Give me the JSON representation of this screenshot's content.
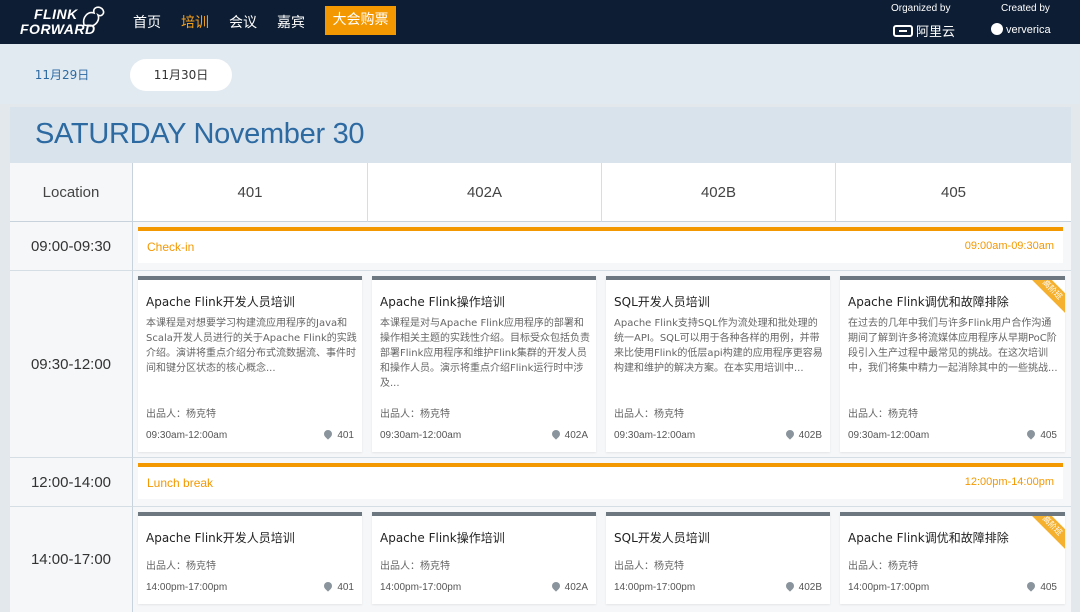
{
  "brand": {
    "line1": "FLINK",
    "line2": "FORWARD"
  },
  "nav": {
    "items": [
      {
        "label": "首页"
      },
      {
        "label": "培训"
      },
      {
        "label": "会议"
      },
      {
        "label": "嘉宾"
      }
    ],
    "active_item": "培训",
    "ticket_label": "大会购票",
    "ticket_color": "#f39800"
  },
  "sponsors": {
    "organized_label": "Organized by",
    "organizer": "阿里云",
    "created_label": "Created by",
    "creator": "ververica"
  },
  "dates": {
    "tabs": [
      {
        "label": "11月29日"
      },
      {
        "label": "11月30日"
      }
    ],
    "selected": "11月30日"
  },
  "day_title": "SATURDAY November 30",
  "columns": {
    "location_label": "Location",
    "rooms": [
      "401",
      "402A",
      "402B",
      "405"
    ]
  },
  "slots": {
    "checkin": {
      "time": "09:00-09:30",
      "label": "Check-in",
      "range": "09:00am-09:30am"
    },
    "morning": {
      "time": "09:30-12:00"
    },
    "lunch": {
      "time": "12:00-14:00",
      "label": "Lunch break",
      "range": "12:00pm-14:00pm"
    },
    "afternoon": {
      "time": "14:00-17:00"
    }
  },
  "morning_sessions": [
    {
      "title": "Apache Flink开发人员培训",
      "desc": "本课程是对想要学习构建流应用程序的Java和Scala开发人员进行的关于Apache Flink的实践介绍。演讲将重点介绍分布式流数据流、事件时间和键分区状态的核心概念...",
      "producer": "出品人：杨克特",
      "time": "09:30am-12:00am",
      "room": "401"
    },
    {
      "title": "Apache Flink操作培训",
      "desc": "本课程是对与Apache Flink应用程序的部署和操作相关主题的实践性介绍。目标受众包括负责部署Flink应用程序和维护Flink集群的开发人员和操作人员。演示将重点介绍Flink运行时中涉及...",
      "producer": "出品人：杨克特",
      "time": "09:30am-12:00am",
      "room": "402A"
    },
    {
      "title": "SQL开发人员培训",
      "desc": "Apache Flink支持SQL作为流处理和批处理的统一API。SQL可以用于各种各样的用例，并带来比使用Flink的低层api构建的应用程序更容易构建和维护的解决方案。在本实用培训中...",
      "producer": "出品人：杨克特",
      "time": "09:30am-12:00am",
      "room": "402B"
    },
    {
      "title": "Apache Flink调优和故障排除",
      "desc": "在过去的几年中我们与许多Flink用户合作沟通期间了解到许多将流媒体应用程序从早期PoC阶段引入生产过程中最常见的挑战。在这次培训中，我们将集中精力一起消除其中的一些挑战...",
      "producer": "出品人：杨克特",
      "time": "09:30am-12:00am",
      "room": "405",
      "badge": "高阶班"
    }
  ],
  "afternoon_sessions": [
    {
      "title": "Apache Flink开发人员培训",
      "producer": "出品人：杨克特",
      "time": "14:00pm-17:00pm",
      "room": "401"
    },
    {
      "title": "Apache Flink操作培训",
      "producer": "出品人：杨克特",
      "time": "14:00pm-17:00pm",
      "room": "402A"
    },
    {
      "title": "SQL开发人员培训",
      "producer": "出品人：杨克特",
      "time": "14:00pm-17:00pm",
      "room": "402B"
    },
    {
      "title": "Apache Flink调优和故障排除",
      "producer": "出品人：杨克特",
      "time": "14:00pm-17:00pm",
      "room": "405",
      "badge": "高阶班"
    }
  ],
  "colors": {
    "accent": "#f39800",
    "header_bg": "#0d1d33",
    "title_blue": "#2d6aa2"
  }
}
